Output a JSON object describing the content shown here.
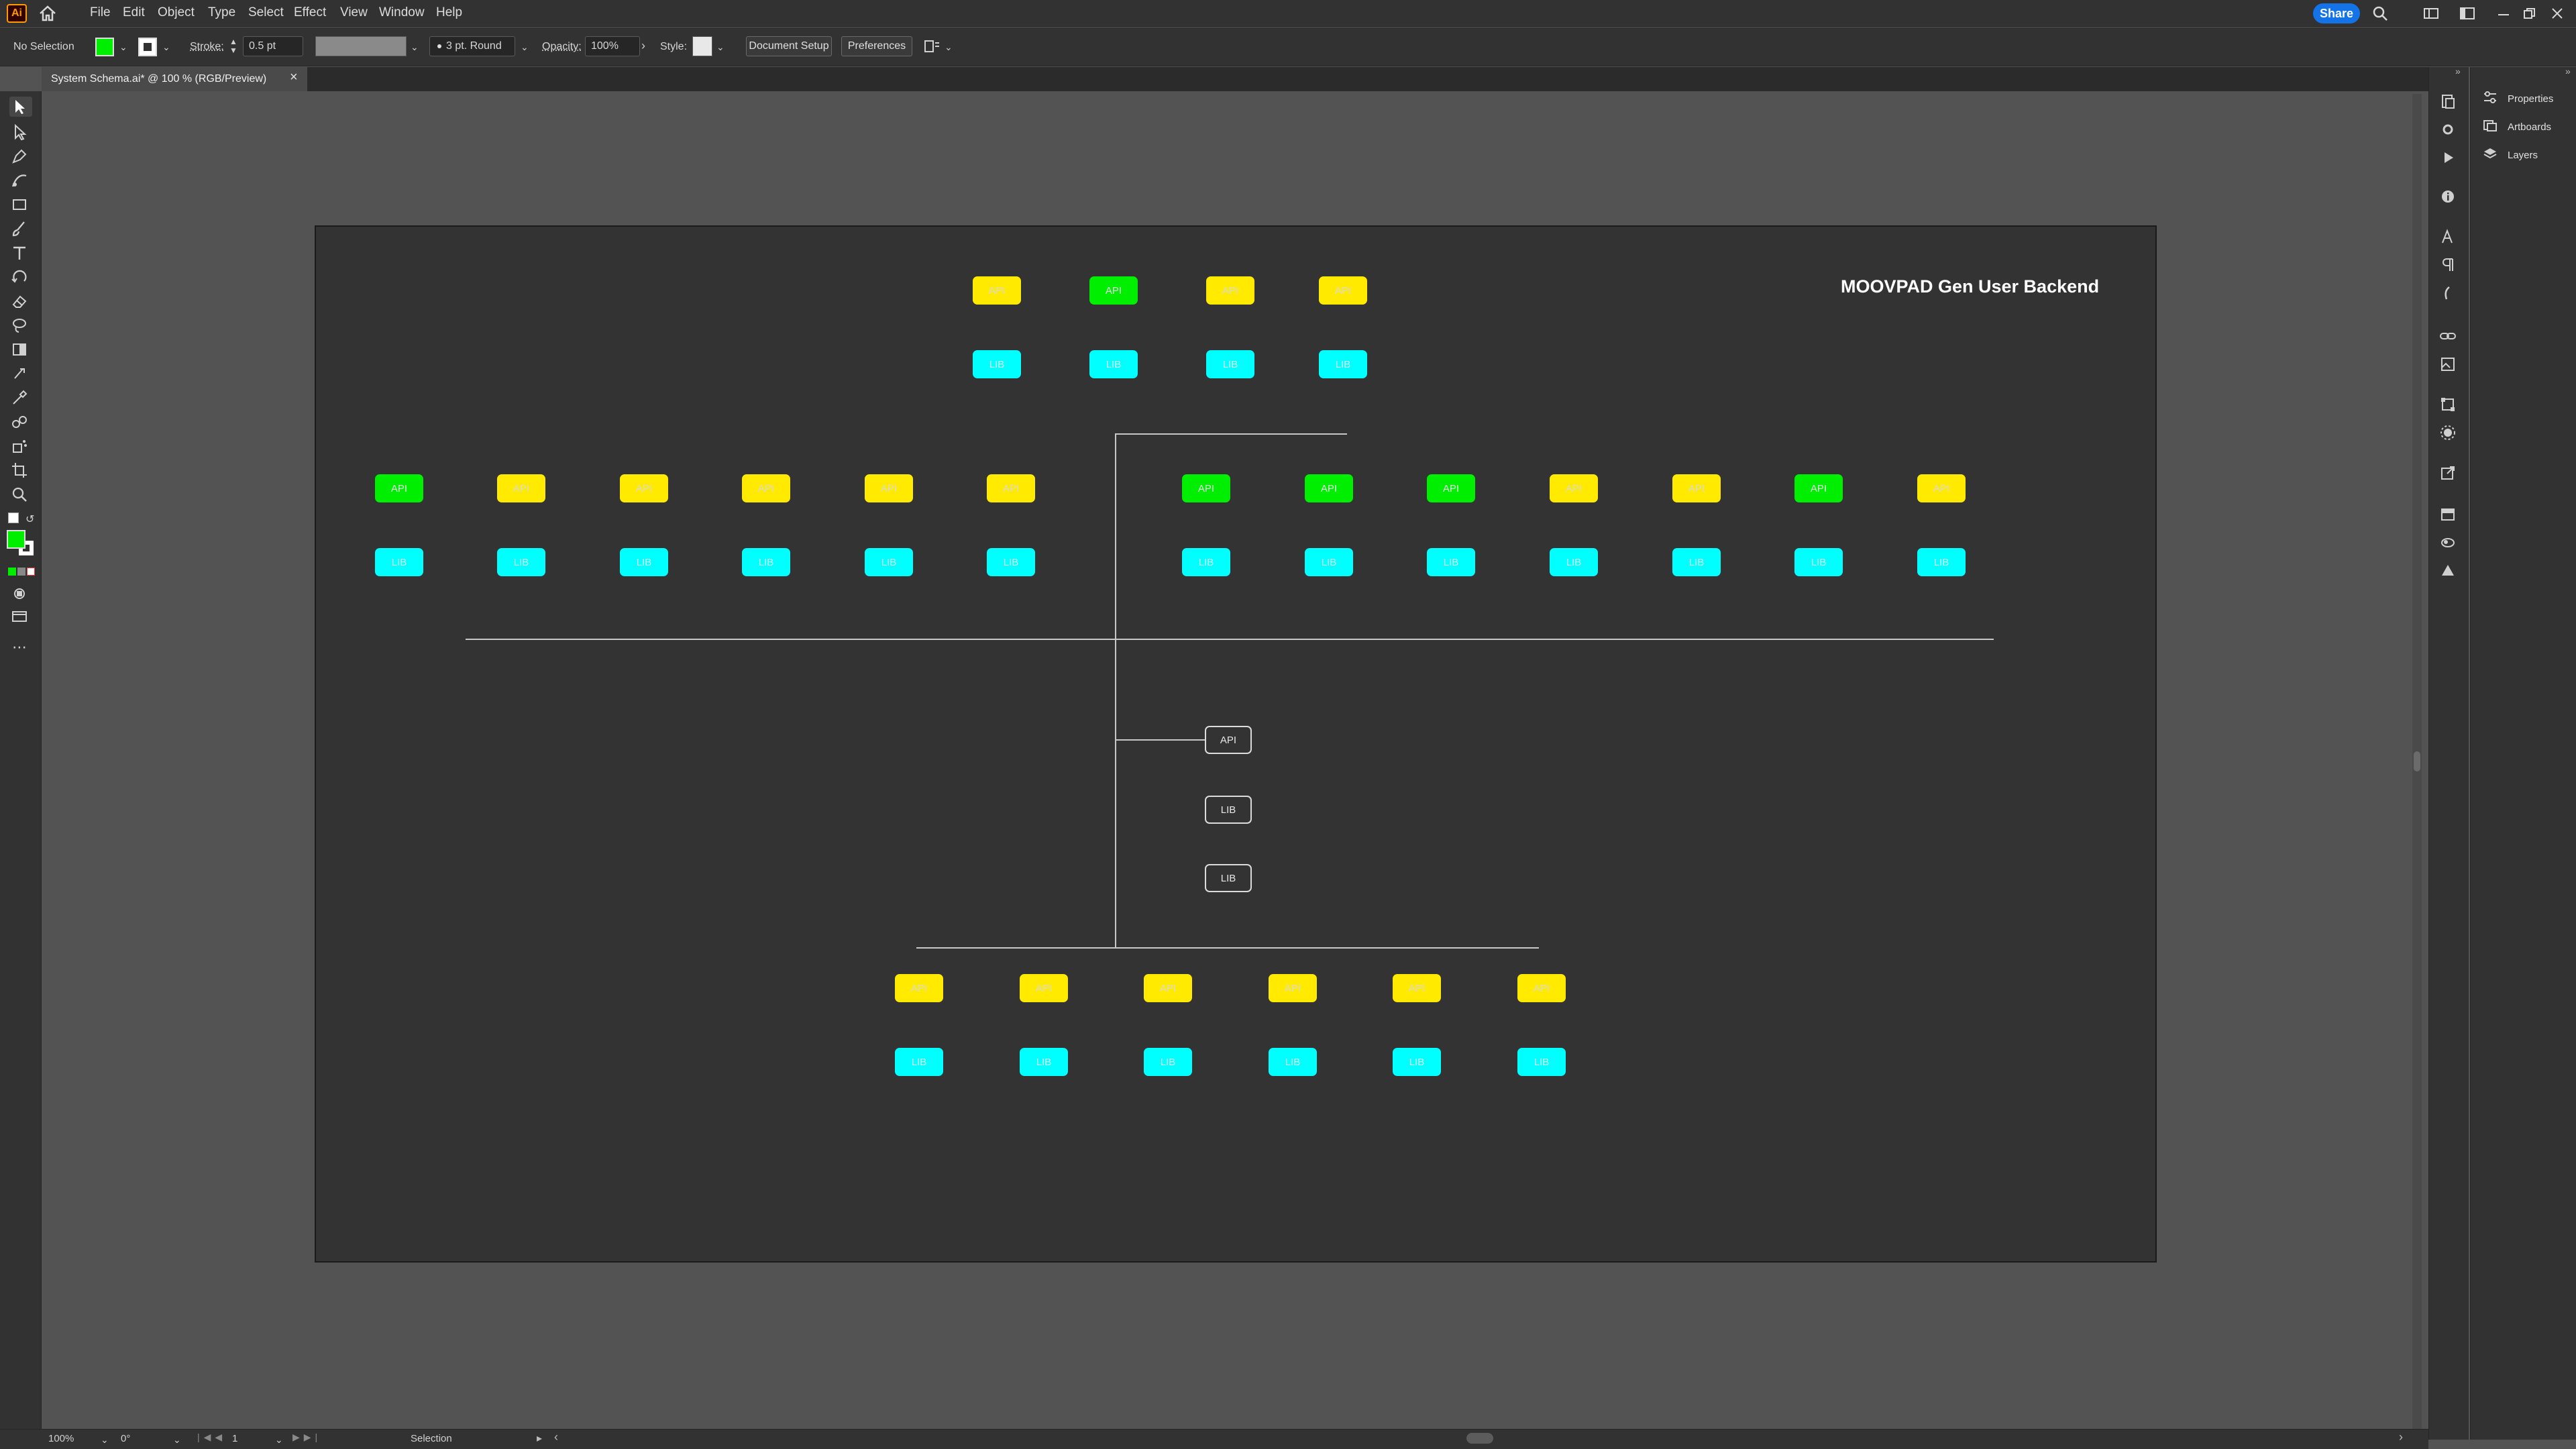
{
  "menubar": {
    "logo": "Ai",
    "items": [
      "File",
      "Edit",
      "Object",
      "Type",
      "Select",
      "Effect",
      "View",
      "Window",
      "Help"
    ],
    "share_label": "Share"
  },
  "control": {
    "selection": "No Selection",
    "stroke_label": "Stroke:",
    "stroke_value": "0.5 pt",
    "brush": "3 pt. Round",
    "opacity_label": "Opacity:",
    "opacity_value": "100%",
    "style_label": "Style:",
    "document_setup": "Document Setup",
    "preferences": "Preferences",
    "fill_color": "#00ee00"
  },
  "document": {
    "tab_title": "System Schema.ai* @ 100 % (RGB/Preview)"
  },
  "artboard": {
    "title": "MOOVPAD Gen User Backend",
    "node_labels": {
      "api": "API",
      "lib": "LIB"
    },
    "colors": {
      "yellow": "#ffea00",
      "green": "#00ee00",
      "cyan": "#00ffff"
    },
    "top_group_api_colors": [
      "yellow",
      "green",
      "yellow",
      "yellow"
    ],
    "left_group_api_colors": [
      "green",
      "yellow",
      "yellow",
      "yellow",
      "yellow",
      "yellow"
    ],
    "right_group_api_colors": [
      "green",
      "green",
      "green",
      "yellow",
      "yellow",
      "green",
      "yellow"
    ],
    "bottom_group_api_colors": [
      "yellow",
      "yellow",
      "yellow",
      "yellow",
      "yellow",
      "yellow"
    ],
    "center_nodes": [
      "API",
      "LIB",
      "LIB"
    ]
  },
  "panel": {
    "items": [
      "Properties",
      "Artboards",
      "Layers"
    ]
  },
  "status": {
    "zoom": "100%",
    "rotation": "0°",
    "artboard_number": "1",
    "tool": "Selection"
  }
}
